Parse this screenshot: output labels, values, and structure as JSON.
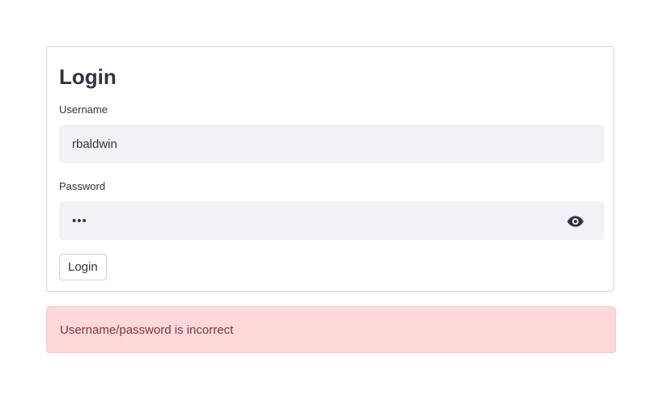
{
  "form": {
    "title": "Login",
    "username_label": "Username",
    "username_value": "rbaldwin",
    "password_label": "Password",
    "password_value": "abc",
    "password_toggle_icon": "eye-icon",
    "submit_label": "Login"
  },
  "alert": {
    "type": "error",
    "message": "Username/password is incorrect",
    "colors": {
      "background": "#ffd8d9",
      "text": "#7d353b"
    }
  }
}
